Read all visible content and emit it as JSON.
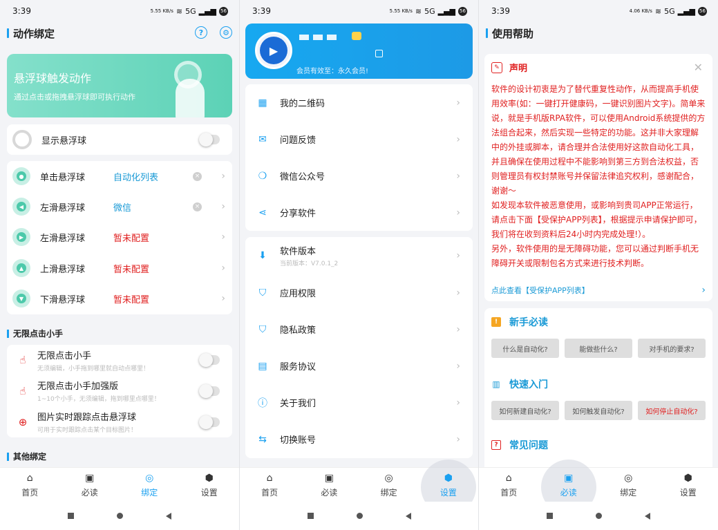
{
  "panel1": {
    "status": {
      "time": "3:39",
      "net": "5.55 KB/s",
      "signal": "5G",
      "battery": "56"
    },
    "title": "动作绑定",
    "help_icon": "question-icon",
    "settings_icon": "gear-icon",
    "hero": {
      "title": "悬浮球触发动作",
      "subtitle": "通过点击或拖拽悬浮球即可执行动作"
    },
    "show_ball": {
      "label": "显示悬浮球"
    },
    "bindings": [
      {
        "label": "单击悬浮球",
        "value": "自动化列表",
        "status": "set"
      },
      {
        "label": "左滑悬浮球",
        "value": "微信",
        "status": "set"
      },
      {
        "label": "左滑悬浮球",
        "value": "暂未配置",
        "status": "unset"
      },
      {
        "label": "上滑悬浮球",
        "value": "暂未配置",
        "status": "unset"
      },
      {
        "label": "下滑悬浮球",
        "value": "暂未配置",
        "status": "unset"
      }
    ],
    "section_unlimited": "无限点击小手",
    "taps": [
      {
        "title": "无限点击小手",
        "desc": "无须编辑，小手拖到哪里就自动点哪里！"
      },
      {
        "title": "无限点击小手加强版",
        "desc": "1~10个小手，无须编辑，拖到哪里点哪里！"
      },
      {
        "title": "图片实时跟踪点击悬浮球",
        "desc": "可用于实时跟踪点击某个目标图片！"
      }
    ],
    "section_other": "其他绑定",
    "nav": [
      "首页",
      "必读",
      "绑定",
      "设置"
    ],
    "active_nav": 2
  },
  "panel2": {
    "status": {
      "time": "3:39",
      "net": "5.55 KB/s",
      "signal": "5G",
      "battery": "56"
    },
    "profile": {
      "vip_text": "会员有效至：永久会员!"
    },
    "group1": [
      {
        "label": "我的二维码",
        "icon": "qr-code-icon"
      },
      {
        "label": "问题反馈",
        "icon": "mail-icon"
      },
      {
        "label": "微信公众号",
        "icon": "wechat-icon"
      },
      {
        "label": "分享软件",
        "icon": "share-icon"
      }
    ],
    "group2": [
      {
        "label": "软件版本",
        "sub": "当前版本：V7.0.1_2",
        "icon": "download-icon"
      },
      {
        "label": "应用权限",
        "icon": "shield-icon"
      },
      {
        "label": "隐私政策",
        "icon": "privacy-shield-icon"
      },
      {
        "label": "服务协议",
        "icon": "document-icon"
      },
      {
        "label": "关于我们",
        "icon": "info-icon"
      },
      {
        "label": "切换账号",
        "icon": "switch-account-icon"
      }
    ],
    "nav": [
      "首页",
      "必读",
      "绑定",
      "设置"
    ],
    "active_nav": 3
  },
  "panel3": {
    "status": {
      "time": "3:39",
      "net": "4.06 KB/s",
      "signal": "5G",
      "battery": "56"
    },
    "title": "使用帮助",
    "notice": {
      "heading": "声明",
      "body1": "软件的设计初衷是为了替代重复性动作，从而提高手机使用效率(如：一键打开健康码，一键识别图片文字)。简单来说，就是手机版RPA软件，可以使用Android系统提供的方法组合起来，然后实现一些特定的功能。这并非大家理解中的外挂或脚本，请合理并合法使用好这款自动化工具，并且确保在使用过程中不能影响到第三方到合法权益，否则管理员有权封禁账号并保留法律追究权利，感谢配合，谢谢～",
      "body2": "如发现本软件被恶意使用，或影响到贵司APP正常运行，请点击下面【受保护APP列表】，根据提示申请保护即可，我们将在收到资料后24小时内完成处理!）。",
      "body3": "另外，软件使用的是无障碍功能，您可以通过判断手机无障碍开关或限制包名方式来进行技术判断。",
      "link": "点此查看【受保护APP列表】"
    },
    "sections": [
      {
        "title": "新手必读",
        "chips": [
          "什么是自动化?",
          "能做些什么?",
          "对手机的要求?"
        ],
        "highlight": -1
      },
      {
        "title": "快速入门",
        "chips": [
          "如何新建自动化?",
          "如何触发自动化?",
          "如何停止自动化?"
        ],
        "highlight": 2
      },
      {
        "title": "常见问题",
        "chips": [],
        "highlight": -1
      }
    ],
    "nav": [
      "首页",
      "必读",
      "绑定",
      "设置"
    ],
    "active_nav": 1
  }
}
